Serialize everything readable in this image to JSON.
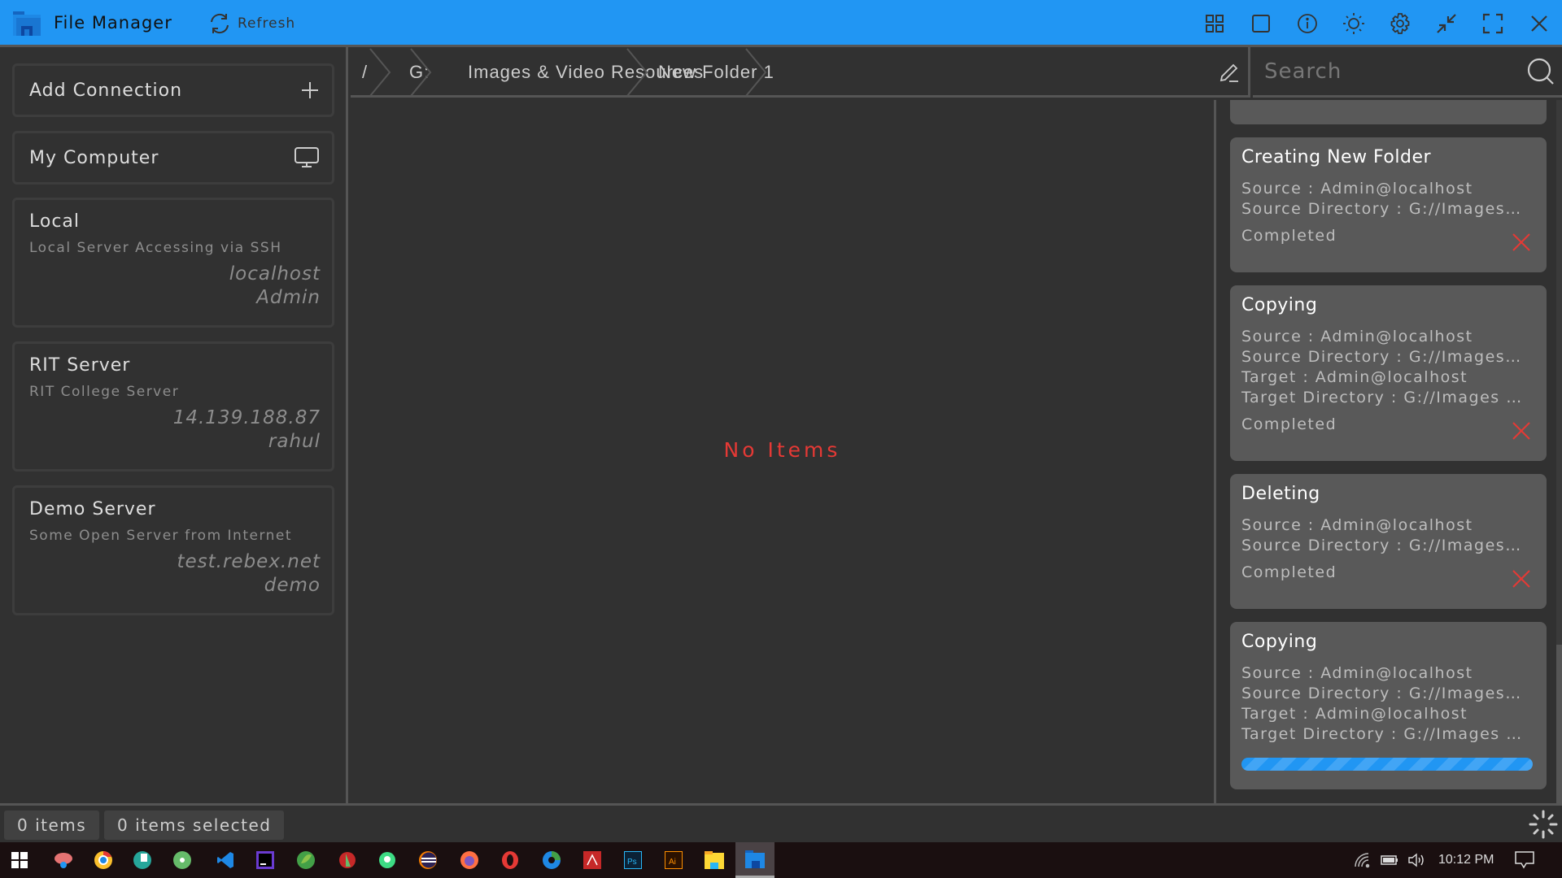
{
  "app": {
    "title": "File Manager",
    "refresh_label": "Refresh",
    "accent_color": "#2196F3",
    "title_icons": [
      "grid-view-icon",
      "single-view-icon",
      "info-icon",
      "theme-sun-icon",
      "settings-gear-icon",
      "minimize-compress-icon",
      "fullscreen-icon",
      "close-icon"
    ]
  },
  "sidebar": {
    "add_connection": "Add Connection",
    "my_computer": "My Computer",
    "connections": [
      {
        "name": "Local",
        "description": "Local Server Accessing via SSH",
        "host": "localhost",
        "user": "Admin"
      },
      {
        "name": "RIT Server",
        "description": "RIT College Server",
        "host": "14.139.188.87",
        "user": "rahul"
      },
      {
        "name": "Demo Server",
        "description": "Some Open Server from Internet",
        "host": "test.rebex.net",
        "user": "demo"
      }
    ]
  },
  "breadcrumb": [
    "/",
    "G:",
    "Images & Video Resources",
    "New Folder 1"
  ],
  "search": {
    "placeholder": "Search",
    "value": ""
  },
  "main": {
    "empty_text": "No Items"
  },
  "tasks": [
    {
      "title": "Creating New Folder",
      "lines": [
        "Source : Admin@localhost",
        "Source Directory : G://Images & Video Resources"
      ],
      "status": "Completed"
    },
    {
      "title": "Copying",
      "lines": [
        "Source : Admin@localhost",
        "Source Directory : G://Images & Video Resources",
        "Target : Admin@localhost",
        "Target Directory : G://Images & Video Resources"
      ],
      "status": "Completed"
    },
    {
      "title": "Deleting",
      "lines": [
        "Source : Admin@localhost",
        "Source Directory : G://Images & Video Resources"
      ],
      "status": "Completed"
    },
    {
      "title": "Copying",
      "lines": [
        "Source : Admin@localhost",
        "Source Directory : G://Images & Video Resources",
        "Target : Admin@localhost",
        "Target Directory : G://Images & Video Resources"
      ],
      "status": "In progress",
      "progress": "indeterminate"
    }
  ],
  "statusbar": {
    "items_count": "0 items",
    "selected_count": "0 items selected"
  },
  "taskbar": {
    "apps": [
      "start",
      "snipping-tool",
      "chrome",
      "app-teal",
      "atom",
      "vscode",
      "intellij",
      "spring-tools",
      "app-red",
      "android-studio",
      "eclipse",
      "firefox",
      "opera",
      "edge",
      "acrobat",
      "photoshop",
      "illustrator",
      "file-explorer",
      "file-manager"
    ],
    "time": "10:12 PM"
  }
}
